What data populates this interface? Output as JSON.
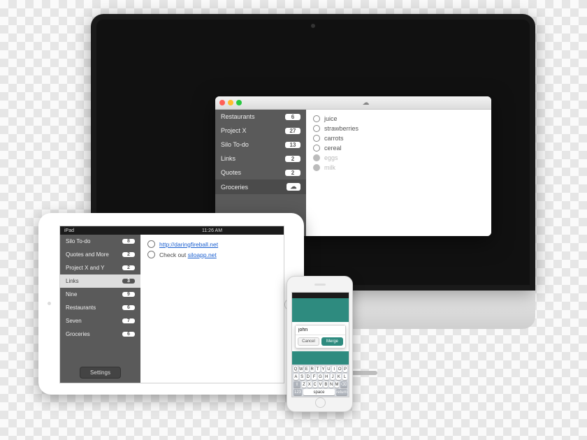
{
  "mac": {
    "sidebar": [
      {
        "label": "Restaurants",
        "count": "6"
      },
      {
        "label": "Project X",
        "count": "27"
      },
      {
        "label": "Silo To-do",
        "count": "13"
      },
      {
        "label": "Links",
        "count": "2"
      },
      {
        "label": "Quotes",
        "count": "2"
      },
      {
        "label": "Groceries",
        "count": "☁"
      }
    ],
    "selected": 5,
    "items": [
      {
        "label": "juice",
        "done": false
      },
      {
        "label": "strawberries",
        "done": false
      },
      {
        "label": "carrots",
        "done": false
      },
      {
        "label": "cereal",
        "done": false
      },
      {
        "label": "eggs",
        "done": true
      },
      {
        "label": "milk",
        "done": true
      }
    ]
  },
  "ipad": {
    "status": {
      "carrier": "iPad",
      "time": "11:26 AM"
    },
    "sidebar": [
      {
        "label": "Silo To-do",
        "count": "8"
      },
      {
        "label": "Quotes and More",
        "count": "2"
      },
      {
        "label": "Project X and Y",
        "count": "2"
      },
      {
        "label": "Links",
        "count": "3"
      },
      {
        "label": "Nine",
        "count": "9"
      },
      {
        "label": "Restaurants",
        "count": "6"
      },
      {
        "label": "Seven",
        "count": "7"
      },
      {
        "label": "Groceries",
        "count": "6"
      }
    ],
    "selected": 3,
    "settings_label": "Settings",
    "items": [
      {
        "prefix": "",
        "link": "http://daringfireball.net",
        "suffix": ""
      },
      {
        "prefix": "Check out ",
        "link": "siloapp.net",
        "suffix": ""
      }
    ]
  },
  "iphone": {
    "input_value": "john",
    "cancel_label": "Cancel",
    "merge_label": "Merge",
    "kbd": {
      "r1": [
        "Q",
        "W",
        "E",
        "R",
        "T",
        "Y",
        "U",
        "I",
        "O",
        "P"
      ],
      "r2": [
        "A",
        "S",
        "D",
        "F",
        "G",
        "H",
        "J",
        "K",
        "L"
      ],
      "r3": [
        "Z",
        "X",
        "C",
        "V",
        "B",
        "N",
        "M"
      ],
      "shift": "⇧",
      "del": "⌫",
      "num": "123",
      "space": "space",
      "ret": "return"
    }
  }
}
